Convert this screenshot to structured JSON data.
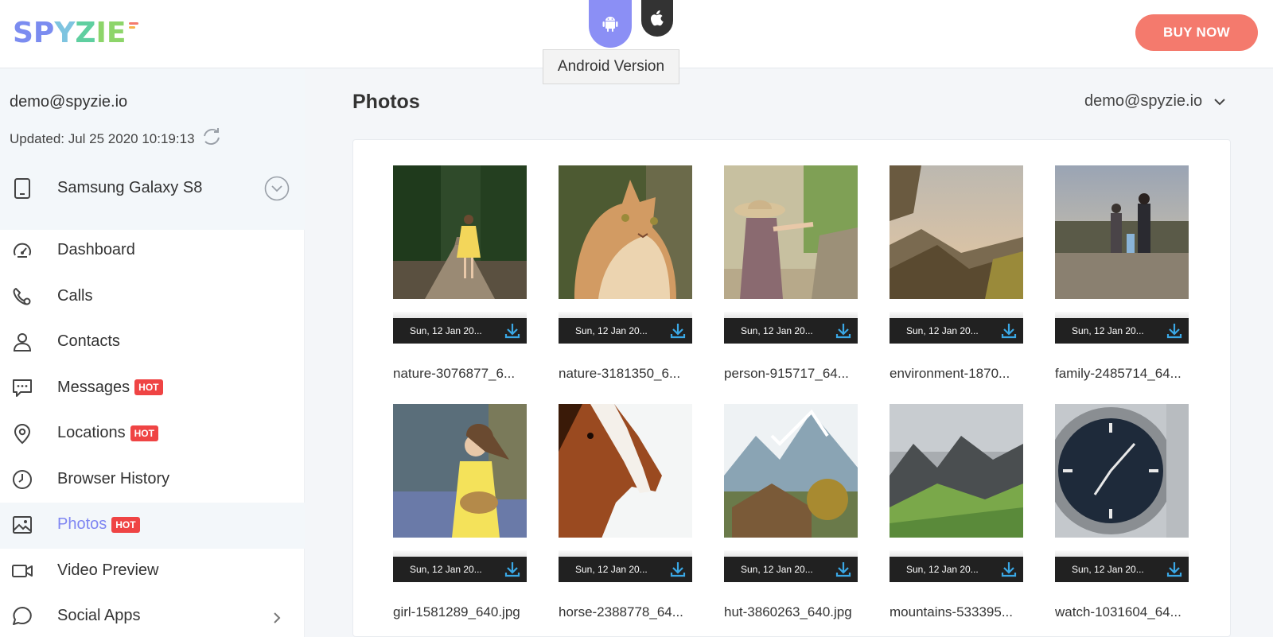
{
  "header": {
    "logo_text": [
      "SP",
      "Y",
      "Z",
      "IE"
    ],
    "tooltip": "Android Version",
    "buy_label": "BUY NOW",
    "colors": {
      "brand": "#7b8cf0",
      "buy": "#f47a6d",
      "android_tab": "#8b8ff5",
      "accent_active": "#7f86f2",
      "hot": "#ef4444"
    }
  },
  "account": {
    "email": "demo@spyzie.io",
    "updated": "Updated: Jul 25 2020 10:19:13",
    "device": "Samsung Galaxy S8"
  },
  "menu": [
    {
      "label": "Dashboard",
      "icon": "gauge-icon",
      "hot": "",
      "active": false
    },
    {
      "label": "Calls",
      "icon": "phone-icon",
      "hot": "",
      "active": false
    },
    {
      "label": "Contacts",
      "icon": "person-icon",
      "hot": "",
      "active": false
    },
    {
      "label": "Messages",
      "icon": "chat-icon",
      "hot": "HOT",
      "active": false
    },
    {
      "label": "Locations",
      "icon": "location-pin-icon",
      "hot": "HOT",
      "active": false
    },
    {
      "label": "Browser History",
      "icon": "clock-icon",
      "hot": "",
      "active": false
    },
    {
      "label": "Photos",
      "icon": "image-icon",
      "hot": "HOT",
      "active": true
    },
    {
      "label": "Video Preview",
      "icon": "video-icon",
      "hot": "",
      "active": false
    },
    {
      "label": "Social Apps",
      "icon": "speech-bubble-icon",
      "hot": "",
      "active": false
    }
  ],
  "main": {
    "title": "Photos",
    "user": "demo@spyzie.io"
  },
  "photos": [
    {
      "date": "Sun, 12 Jan 20...",
      "name": "nature-3076877_6...",
      "scene": "girl in yellow dress on forest path"
    },
    {
      "date": "Sun, 12 Jan 20...",
      "name": "nature-3181350_6...",
      "scene": "ginger cat"
    },
    {
      "date": "Sun, 12 Jan 20...",
      "name": "person-915717_64...",
      "scene": "girl with straw hat"
    },
    {
      "date": "Sun, 12 Jan 20...",
      "name": "environment-1870...",
      "scene": "cliff sunset"
    },
    {
      "date": "Sun, 12 Jan 20...",
      "name": "family-2485714_64...",
      "scene": "family walking"
    },
    {
      "date": "Sun, 12 Jan 20...",
      "name": "girl-1581289_640.jpg",
      "scene": "girl with basket"
    },
    {
      "date": "Sun, 12 Jan 20...",
      "name": "horse-2388778_64...",
      "scene": "horse head"
    },
    {
      "date": "Sun, 12 Jan 20...",
      "name": "hut-3860263_640.jpg",
      "scene": "hut and mountains"
    },
    {
      "date": "Sun, 12 Jan 20...",
      "name": "mountains-533395...",
      "scene": "green mountains"
    },
    {
      "date": "Sun, 12 Jan 20...",
      "name": "watch-1031604_64...",
      "scene": "wrist watch"
    }
  ]
}
